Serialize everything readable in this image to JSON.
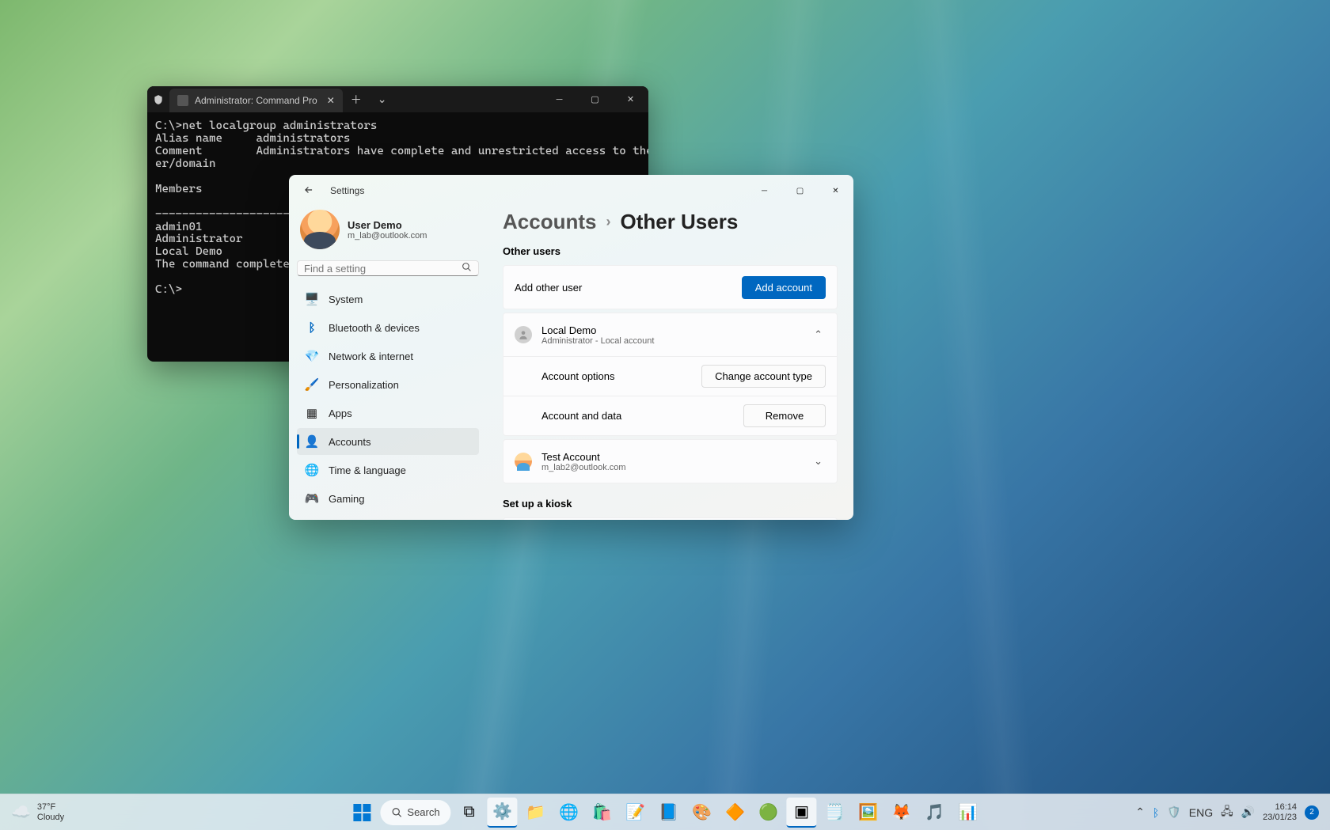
{
  "terminal": {
    "tab_title": "Administrator: Command Pro",
    "output": "C:\\>net localgroup administrators\nAlias name     administrators\nComment        Administrators have complete and unrestricted access to the comput\ner/domain\n\nMembers\n\n-------------------------------------------------------------------------------\nadmin01\nAdministrator\nLocal Demo\nThe command completed s\n\nC:\\>"
  },
  "settings": {
    "title": "Settings",
    "profile": {
      "name": "User Demo",
      "email": "m_lab@outlook.com"
    },
    "search_placeholder": "Find a setting",
    "nav": [
      {
        "icon": "🖥️",
        "label": "System"
      },
      {
        "icon": "ᛒ",
        "label": "Bluetooth & devices"
      },
      {
        "icon": "💎",
        "label": "Network & internet"
      },
      {
        "icon": "🖌️",
        "label": "Personalization"
      },
      {
        "icon": "▦",
        "label": "Apps"
      },
      {
        "icon": "👤",
        "label": "Accounts"
      },
      {
        "icon": "🌐",
        "label": "Time & language"
      },
      {
        "icon": "🎮",
        "label": "Gaming"
      }
    ],
    "breadcrumb": {
      "parent": "Accounts",
      "current": "Other Users"
    },
    "other_users_label": "Other users",
    "add_other_user": "Add other user",
    "add_account_btn": "Add account",
    "users": [
      {
        "name": "Local Demo",
        "subtitle": "Administrator - Local account",
        "expanded": true,
        "account_options": "Account options",
        "change_type_btn": "Change account type",
        "account_and_data": "Account and data",
        "remove_btn": "Remove"
      },
      {
        "name": "Test Account",
        "subtitle": "m_lab2@outlook.com",
        "expanded": false
      }
    ],
    "kiosk_label": "Set up a kiosk"
  },
  "taskbar": {
    "weather": {
      "temp": "37°F",
      "cond": "Cloudy"
    },
    "search_label": "Search",
    "tray": {
      "lang": "ENG",
      "time": "16:14",
      "date": "23/01/23",
      "notif_count": "2"
    }
  }
}
